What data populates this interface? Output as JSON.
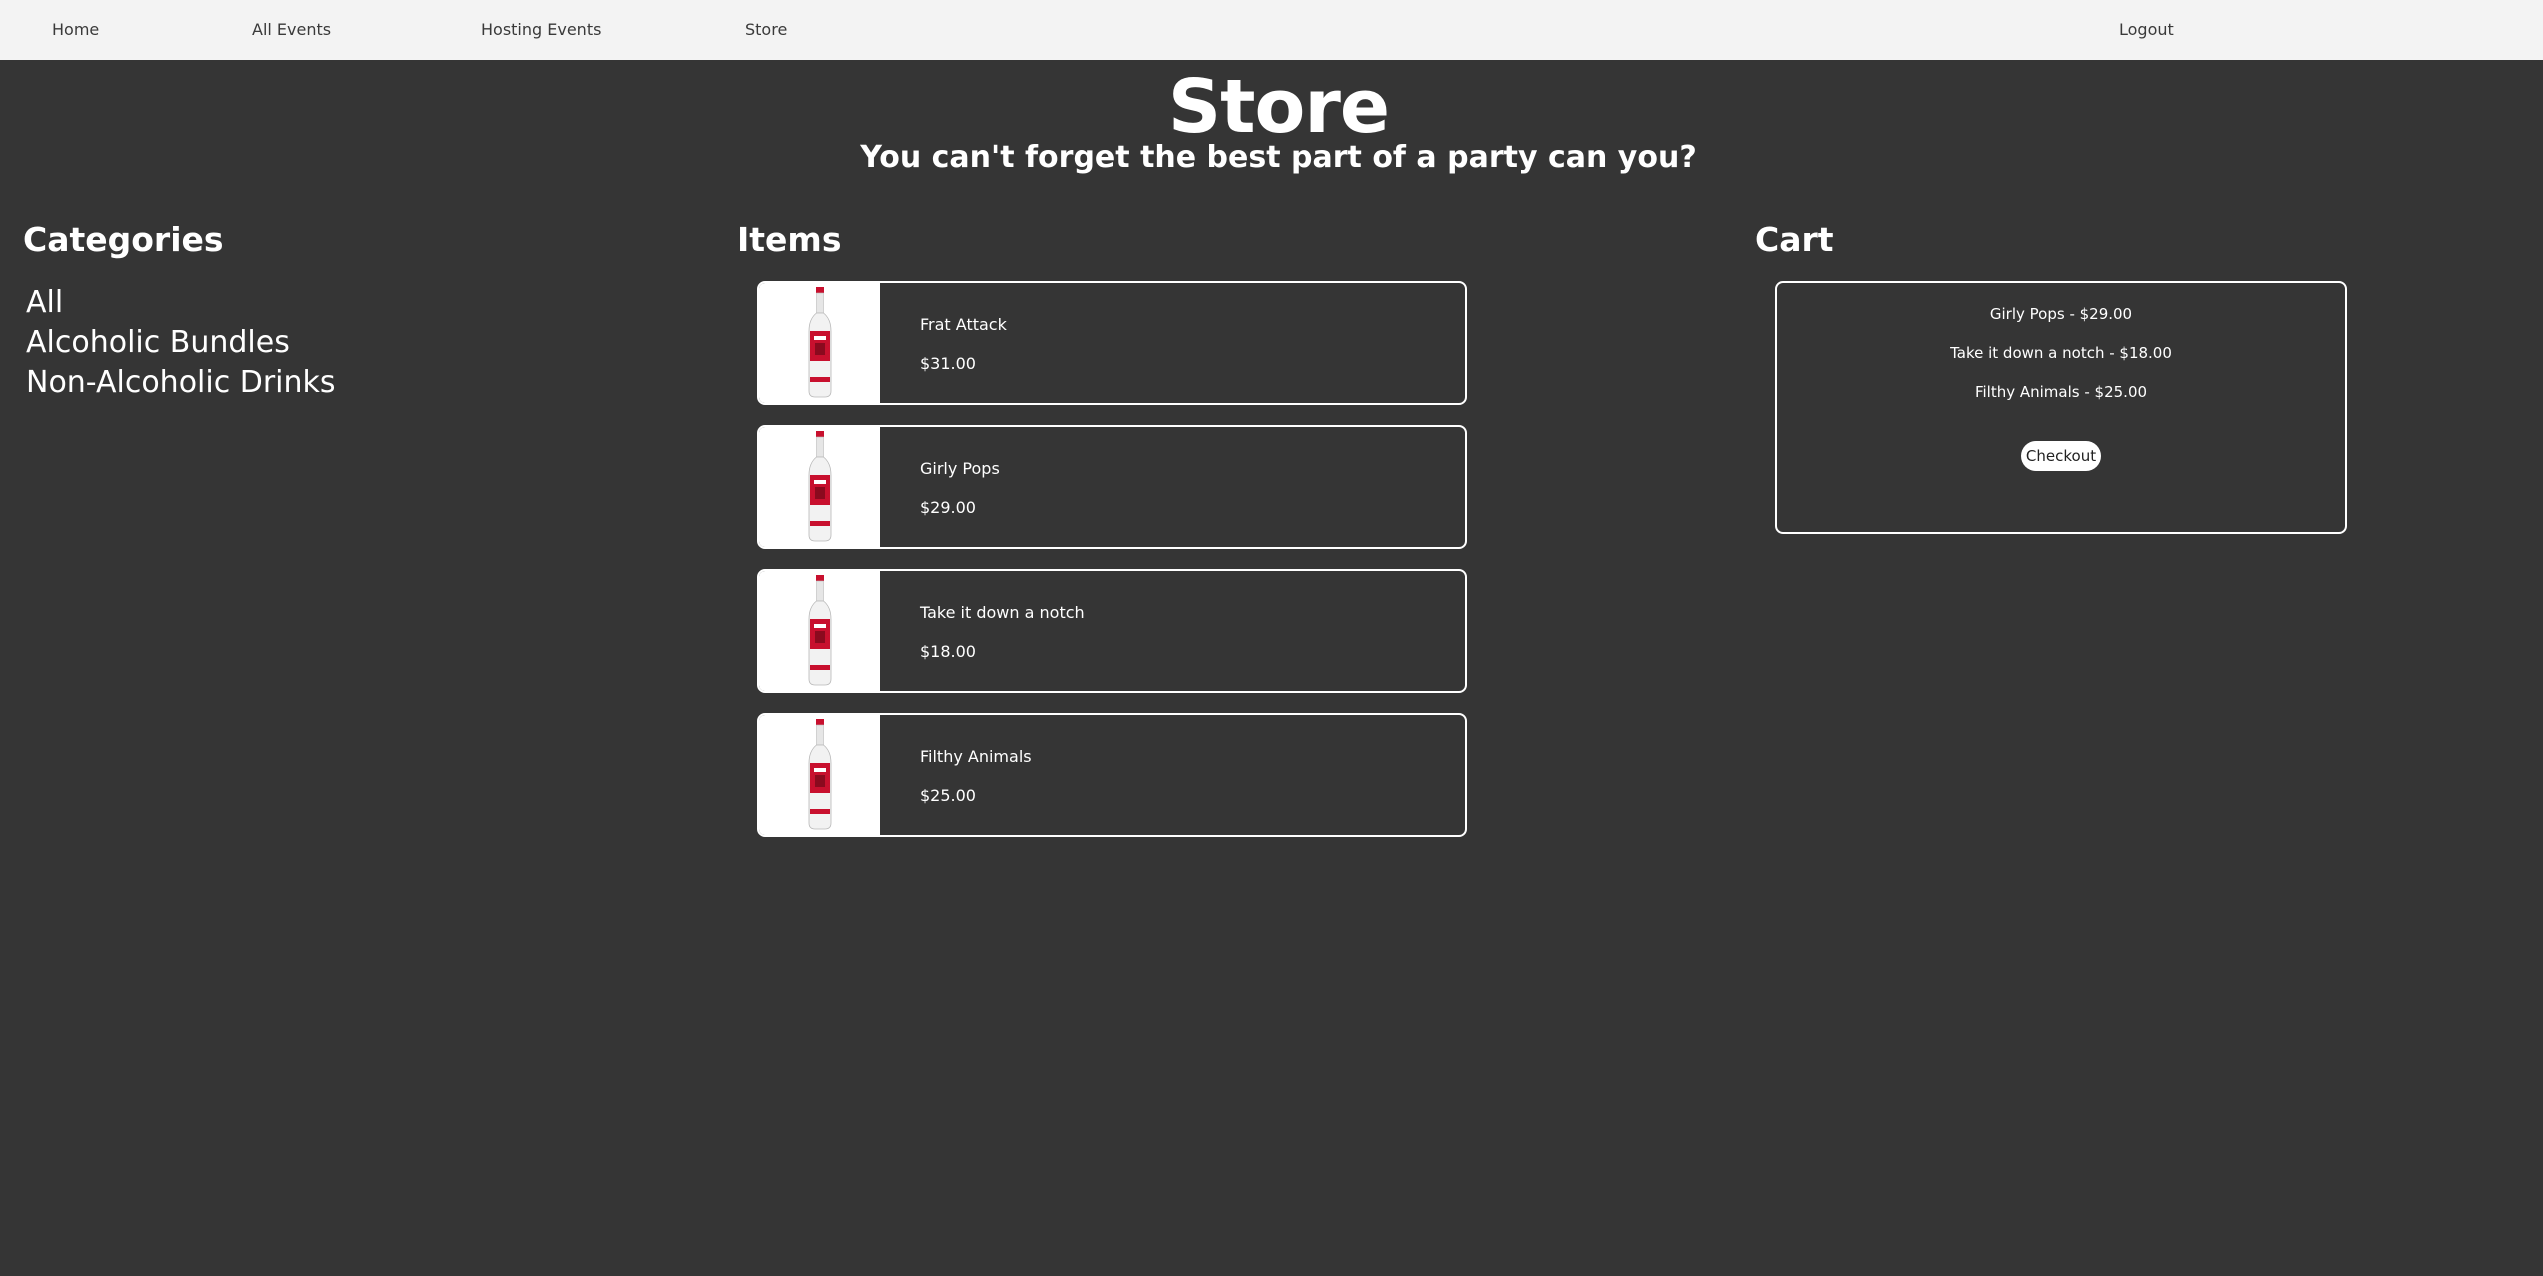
{
  "nav": {
    "home": "Home",
    "all_events": "All Events",
    "hosting_events": "Hosting Events",
    "store": "Store",
    "logout": "Logout"
  },
  "header": {
    "title": "Store",
    "subtitle": "You can't forget the best part of a party can you?"
  },
  "categories": {
    "heading": "Categories",
    "items": [
      "All",
      "Alcoholic Bundles",
      "Non-Alcoholic Drinks"
    ]
  },
  "items": {
    "heading": "Items",
    "list": [
      {
        "name": "Frat Attack",
        "price": "$31.00",
        "icon": "vodka-bottle-icon"
      },
      {
        "name": "Girly Pops",
        "price": "$29.00",
        "icon": "vodka-bottle-icon"
      },
      {
        "name": "Take it down a notch",
        "price": "$18.00",
        "icon": "vodka-bottle-icon"
      },
      {
        "name": "Filthy Animals",
        "price": "$25.00",
        "icon": "vodka-bottle-icon"
      }
    ]
  },
  "cart": {
    "heading": "Cart",
    "lines": [
      "Girly Pops - $29.00",
      "Take it down a notch - $18.00",
      "Filthy Animals - $25.00"
    ],
    "checkout_label": "Checkout"
  },
  "colors": {
    "background": "#353535",
    "navbar": "#f3f3f3",
    "text": "#ffffff",
    "bottle_red": "#c8102e"
  }
}
